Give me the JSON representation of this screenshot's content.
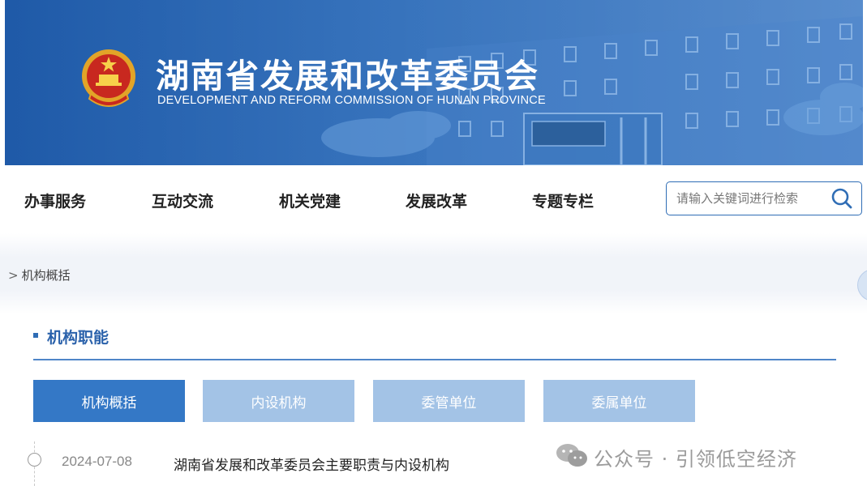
{
  "header": {
    "title": "湖南省发展和改革委员会",
    "subtitle": "DEVELOPMENT AND REFORM COMMISSION OF HUNAN PROVINCE",
    "brand_color": "#2a6ab8"
  },
  "nav": {
    "items": [
      {
        "label": "办事服务"
      },
      {
        "label": "互动交流"
      },
      {
        "label": "机关党建"
      },
      {
        "label": "发展改革"
      },
      {
        "label": "专题专栏"
      }
    ]
  },
  "search": {
    "placeholder": "请输入关键词进行检索",
    "icon": "search-icon"
  },
  "breadcrumb": {
    "separator": ">",
    "current": "机构概括"
  },
  "section": {
    "title": "机构职能"
  },
  "tabs": [
    {
      "label": "机构概括",
      "active": true
    },
    {
      "label": "内设机构",
      "active": false
    },
    {
      "label": "委管单位",
      "active": false
    },
    {
      "label": "委属单位",
      "active": false
    }
  ],
  "list": [
    {
      "date": "2024-07-08",
      "title": "湖南省发展和改革委员会主要职责与内设机构"
    }
  ],
  "watermark": {
    "text": "公众号 · 引领低空经济",
    "icon": "wechat-icon"
  },
  "colors": {
    "accent": "#2f6db5",
    "tab_active": "#3478c6",
    "tab_inactive": "#a3c3e6"
  }
}
